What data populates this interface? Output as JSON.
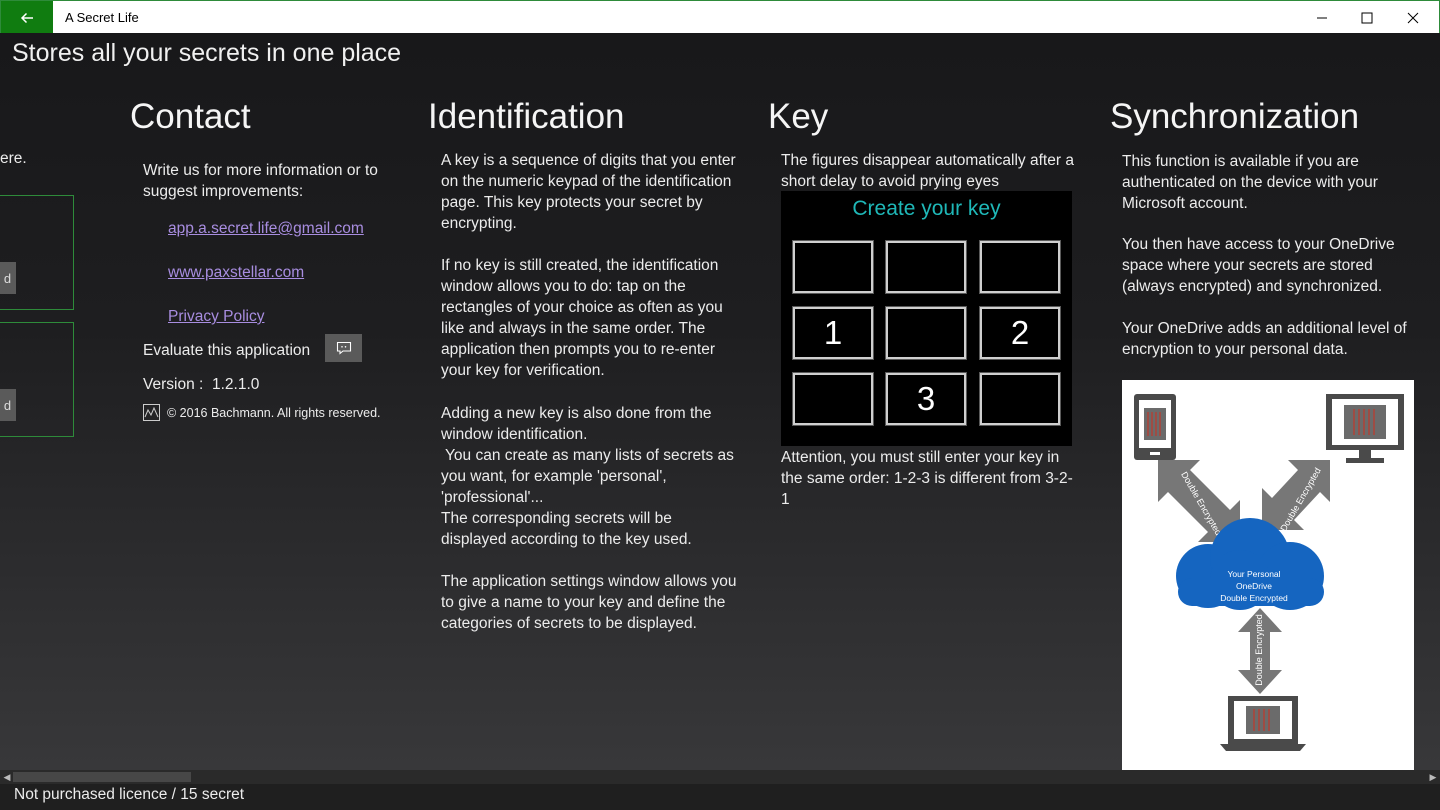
{
  "window": {
    "title": "A Secret Life"
  },
  "app": {
    "subtitle": "Stores all your secrets in one place"
  },
  "partial_column": {
    "text": "ere.",
    "button1": "d",
    "button2": "d"
  },
  "contact": {
    "heading": "Contact",
    "intro": "Write us for more information or to suggest improvements:",
    "email": "app.a.secret.life@gmail.com",
    "website": "www.paxstellar.com",
    "privacy": "Privacy Policy",
    "evaluate": "Evaluate this application",
    "version_label": "Version :",
    "version": "1.2.1.0",
    "copyright": "© 2016 Bachmann. All rights reserved."
  },
  "identification": {
    "heading": "Identification",
    "p1": "A key is a sequence of digits that you enter on the numeric keypad of the identification page. This key protects your secret by encrypting.",
    "p2": "If no key is still created, the identification window allows you to do: tap on the rectangles of your choice as often as you like and always in the same order. The application then prompts you to re-enter your key for verification.",
    "p3": "Adding a new key is also done from the window identification.",
    "p4": "You can create as many lists of secrets as you want, for example 'personal', 'professional'...",
    "p5": "The corresponding secrets will be displayed according to the key used.",
    "p6": "The application settings window allows you to give a name to your key and define the categories of secrets to be displayed."
  },
  "key": {
    "heading": "Key",
    "intro": "The figures disappear automatically after a short delay to avoid prying eyes",
    "image_title": "Create your key",
    "grid": [
      "",
      "",
      "",
      "1",
      "",
      "2",
      "",
      "3",
      ""
    ],
    "note": "Attention, you must still enter your key in the same order: 1-2-3 is different from 3-2-1"
  },
  "sync": {
    "heading": "Synchronization",
    "p1": "This function is available if you are authenticated on the device with your Microsoft account.",
    "p2": "You then have access to your OneDrive space where your secrets are stored (always encrypted) and synchronized.",
    "p3": "Your OneDrive adds an additional level of encryption to your personal data.",
    "diagram": {
      "arrow_label": "Double Encrypted",
      "cloud_line1": "Your Personal",
      "cloud_line2": "OneDrive",
      "cloud_line3": "Double Encrypted"
    }
  },
  "status": {
    "text": "Not purchased licence / 15 secret"
  },
  "colors": {
    "accent": "#107c10",
    "link": "#a88de0",
    "key_title": "#1fb8b8",
    "cloud": "#1565c0"
  }
}
